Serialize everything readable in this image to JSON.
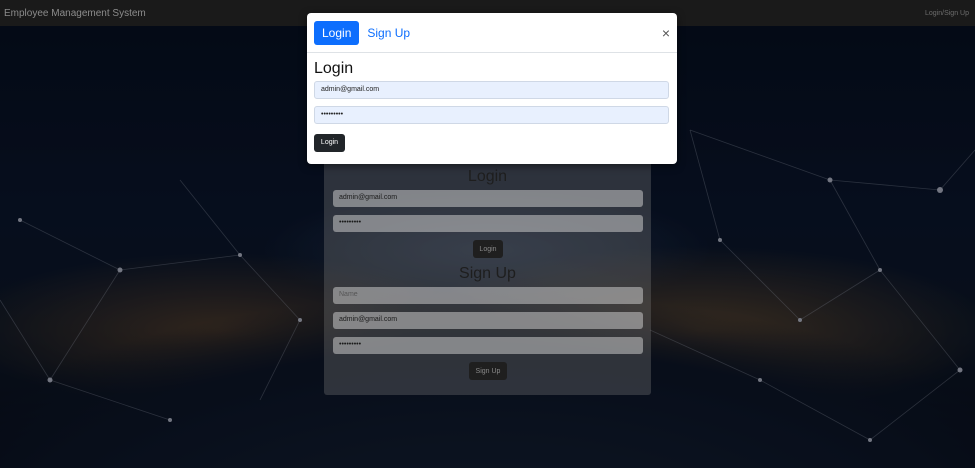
{
  "navbar": {
    "brand": "Employee Management System",
    "link": "Login/Sign Up"
  },
  "modal": {
    "tabs": [
      {
        "label": "Login",
        "active": true
      },
      {
        "label": "Sign Up",
        "active": false
      }
    ],
    "close_icon": "×",
    "title": "Login",
    "email_value": "admin@gmail.com",
    "password_value": "•••••••••",
    "submit_label": "Login"
  },
  "panel": {
    "login_title": "Login",
    "login_email_value": "admin@gmail.com",
    "login_password_value": "•••••••••",
    "login_button": "Login",
    "signup_title": "Sign Up",
    "signup_name_placeholder": "Name",
    "signup_email_value": "admin@gmail.com",
    "signup_password_value": "•••••••••",
    "signup_button": "Sign Up"
  },
  "colors": {
    "primary": "#0d6efd",
    "dark_button": "#212529",
    "navbar": "#1a1a1a",
    "input_autofill": "#e8f0fe"
  }
}
